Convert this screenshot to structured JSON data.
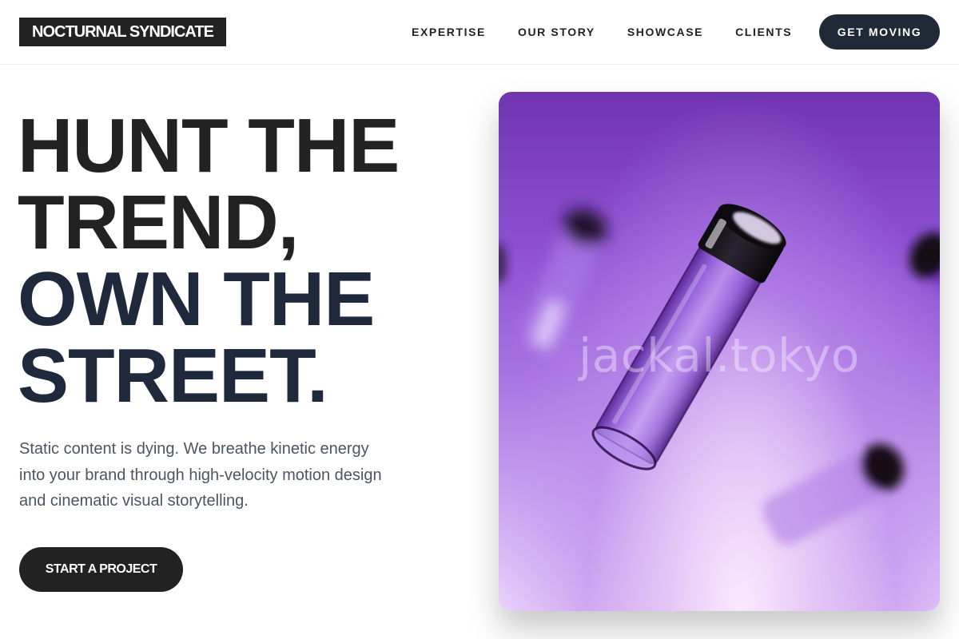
{
  "brand": {
    "logo_text": "NOCTURNAL SYNDICATE"
  },
  "nav": {
    "links": [
      "EXPERTISE",
      "OUR STORY",
      "SHOWCASE",
      "CLIENTS"
    ],
    "cta_label": "GET MOVING"
  },
  "hero": {
    "headline_lines": [
      "HUNT THE",
      "TREND,",
      "OWN THE",
      "STREET."
    ],
    "subtext": "Static content is dying. We breathe kinetic energy into your brand through high-velocity motion design and cinematic visual storytelling.",
    "cta_label": "START A PROJECT"
  },
  "visual": {
    "watermark": "jackal.tokyo",
    "subject": "floating-glass-vials"
  },
  "colors": {
    "primary_dark": "#222222",
    "navy": "#1e293b",
    "button_navy": "#1f2937",
    "body_text": "#4b5563",
    "purple_top": "#7035b0",
    "purple_light": "#ead2fb"
  }
}
